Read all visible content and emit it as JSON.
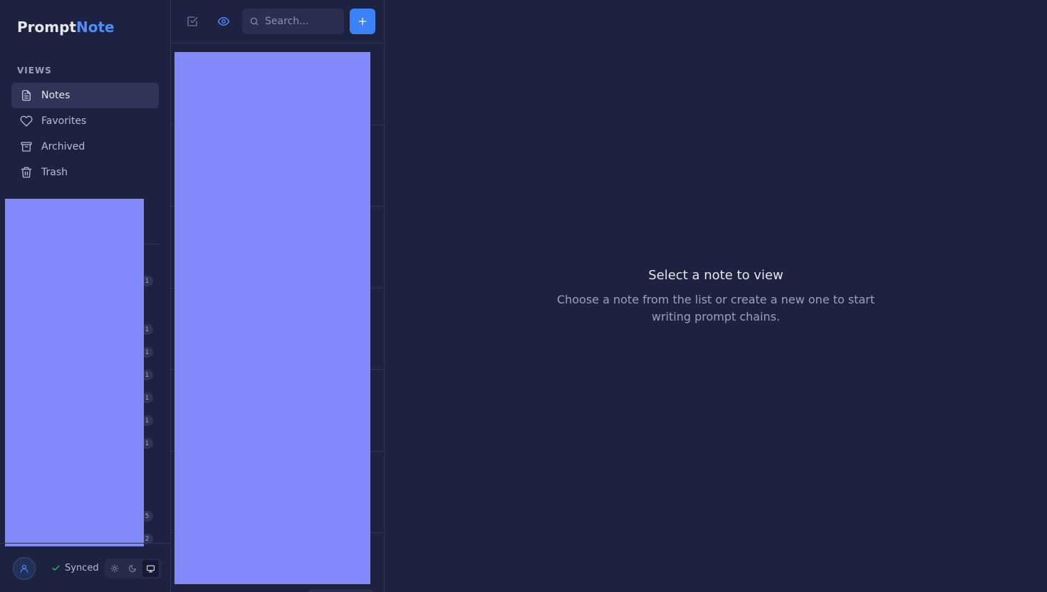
{
  "app": {
    "name_primary": "Prompt",
    "name_accent": "Note"
  },
  "sidebar": {
    "section_label": "VIEWS",
    "items": [
      {
        "label": "Notes",
        "icon": "document-icon",
        "active": true
      },
      {
        "label": "Favorites",
        "icon": "heart-icon",
        "active": false
      },
      {
        "label": "Archived",
        "icon": "archive-icon",
        "active": false
      },
      {
        "label": "Trash",
        "icon": "trash-icon",
        "active": false
      }
    ],
    "counts": [
      "1",
      "1",
      "1",
      "1",
      "1",
      "1",
      "1",
      "5",
      "2"
    ],
    "footer": {
      "sync_status": "Synced",
      "theme_options": [
        "light",
        "dark",
        "system"
      ],
      "theme_selected": "system"
    }
  },
  "toolbar": {
    "search_placeholder": "Search...",
    "add_label": "+"
  },
  "main": {
    "empty_title": "Select a note to view",
    "empty_description": "Choose a note from the list or create a new one to start writing prompt chains."
  },
  "colors": {
    "background": "#1e2241",
    "accent": "#4f8ef7",
    "add_button": "#3b82f6",
    "overlay": "#8289f8",
    "synced_check": "#22c55e"
  }
}
